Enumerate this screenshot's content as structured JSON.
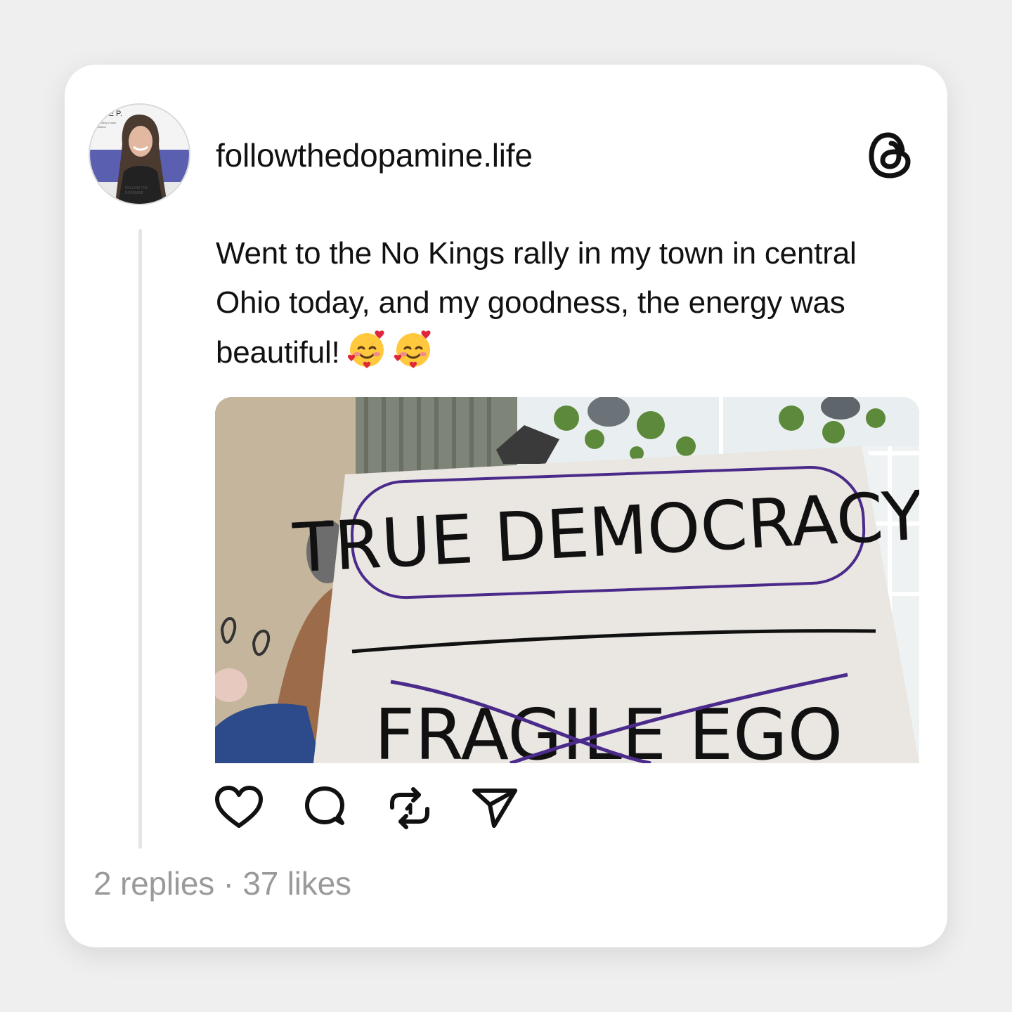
{
  "post": {
    "username": "followthedopamine.life",
    "avatar_text": {
      "name": "KATE P.",
      "sub_line1": "Founding Coach",
      "sub_line2": "+ Author",
      "badge1": "FOLLOW THE",
      "badge2": "DOPAMINE"
    },
    "text": "Went to the No Kings rally in my town in central Ohio today, and my goodness, the energy was beautiful!",
    "emojis": [
      "smiling-face-with-hearts",
      "smiling-face-with-hearts"
    ],
    "image": {
      "sign_line1": "TRUE DEMOCRACY",
      "sign_line2": "FRAGILE EGO"
    },
    "stats": {
      "replies": "2 replies",
      "separator": "·",
      "likes": "37 likes"
    }
  },
  "icons": {
    "brand": "threads-logo-icon",
    "actions": [
      "heart-icon",
      "comment-icon",
      "repost-icon",
      "share-icon"
    ]
  },
  "colors": {
    "background": "#efefef",
    "card": "#ffffff",
    "text": "#111111",
    "muted": "#9a9a9a",
    "avatar_accent": "#5a5fb0",
    "sign_accent": "#4a2a8a"
  }
}
